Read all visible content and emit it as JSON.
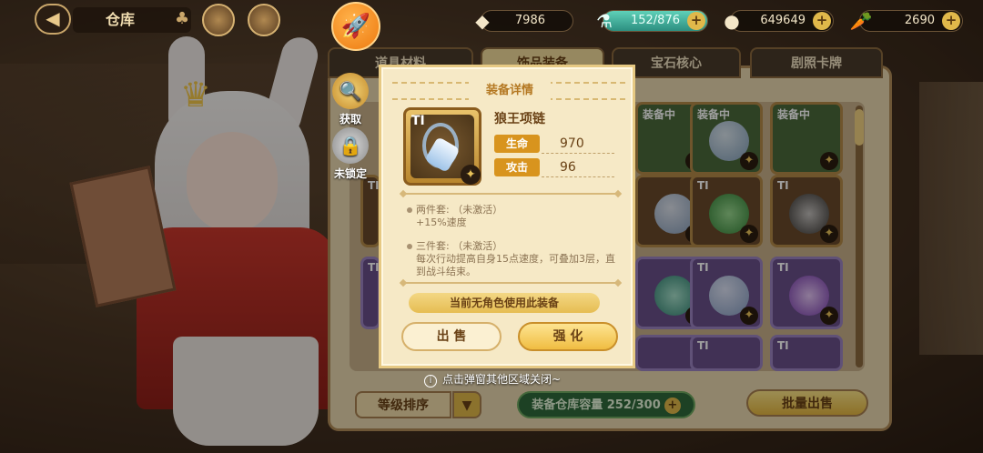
{
  "header": {
    "back_icon": "back-arrow-icon",
    "title": "仓库",
    "resources": [
      {
        "name": "crystal",
        "icon": "purple-crystal-icon",
        "value": "7986"
      },
      {
        "name": "energy",
        "icon": "potion-icon",
        "value": "152/876"
      },
      {
        "name": "coins",
        "icon": "coin-icon",
        "value": "649649"
      },
      {
        "name": "carrots",
        "icon": "carrot-icon",
        "value": "2690"
      }
    ]
  },
  "side_actions": {
    "acquire_label": "获取",
    "unlocked_label": "未锁定"
  },
  "tabs": [
    {
      "label": "道具材料"
    },
    {
      "label": "饰品装备"
    },
    {
      "label": "宝石核心"
    },
    {
      "label": "剧照卡牌"
    }
  ],
  "bottom": {
    "sort_label": "等级排序",
    "capacity_label": "装备仓库容量 252/300",
    "bulk_sell_label": "批量出售"
  },
  "modal": {
    "title": "装备详情",
    "item": {
      "tier": "TI",
      "name": "狼王项链",
      "stats": [
        {
          "label": "生命",
          "value": "970"
        },
        {
          "label": "攻击",
          "value": "96"
        }
      ]
    },
    "set_bonus": [
      {
        "title": "两件套:  （未激活）",
        "desc": "+15%速度"
      },
      {
        "title": "三件套:  （未激活）",
        "desc": "每次行动提高自身15点速度，可叠加3层，直到战斗结束。"
      }
    ],
    "notice": "当前无角色使用此装备",
    "sell_label": "出 售",
    "enhance_label": "强 化"
  },
  "hint": "点击弹窗其他区域关闭~",
  "grid_badges": {
    "equipped": "装备中",
    "tier": "TI",
    "plus5": "+5"
  },
  "colors": {
    "accent_gold": "#e0b84a",
    "stat_label": "#d8941e",
    "title_text": "#b47822"
  }
}
